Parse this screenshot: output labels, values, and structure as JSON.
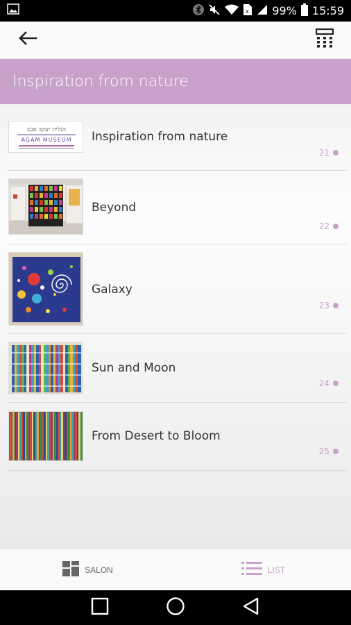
{
  "status_bar": {
    "battery": "99%",
    "time": "15:59"
  },
  "header": {
    "title": "Inspiration from nature"
  },
  "items": [
    {
      "label": "Inspiration from nature",
      "number": "21",
      "thumb": "logo",
      "logo_line1": "הגליה יעקב אגם",
      "logo_line2": "AGAM MUSEUM"
    },
    {
      "label": "Beyond",
      "number": "22",
      "thumb": "gallery"
    },
    {
      "label": "Galaxy",
      "number": "23",
      "thumb": "galaxy"
    },
    {
      "label": "Sun and Moon",
      "number": "24",
      "thumb": "stripes"
    },
    {
      "label": "From Desert to Bloom",
      "number": "25",
      "thumb": "bloom"
    }
  ],
  "tabs": {
    "salon_label": "SALON",
    "list_label": "LIST"
  },
  "colors": {
    "accent": "#c8a2cb",
    "text": "#333333",
    "tab_inactive": "#666666"
  },
  "icons": [
    "image-icon",
    "bluetooth-icon",
    "mute-icon",
    "wifi-icon",
    "signal-icon",
    "battery-icon",
    "back-arrow-icon",
    "calculator-icon",
    "salon-grid-icon",
    "list-icon",
    "recent-apps-icon",
    "home-icon",
    "back-nav-icon"
  ]
}
